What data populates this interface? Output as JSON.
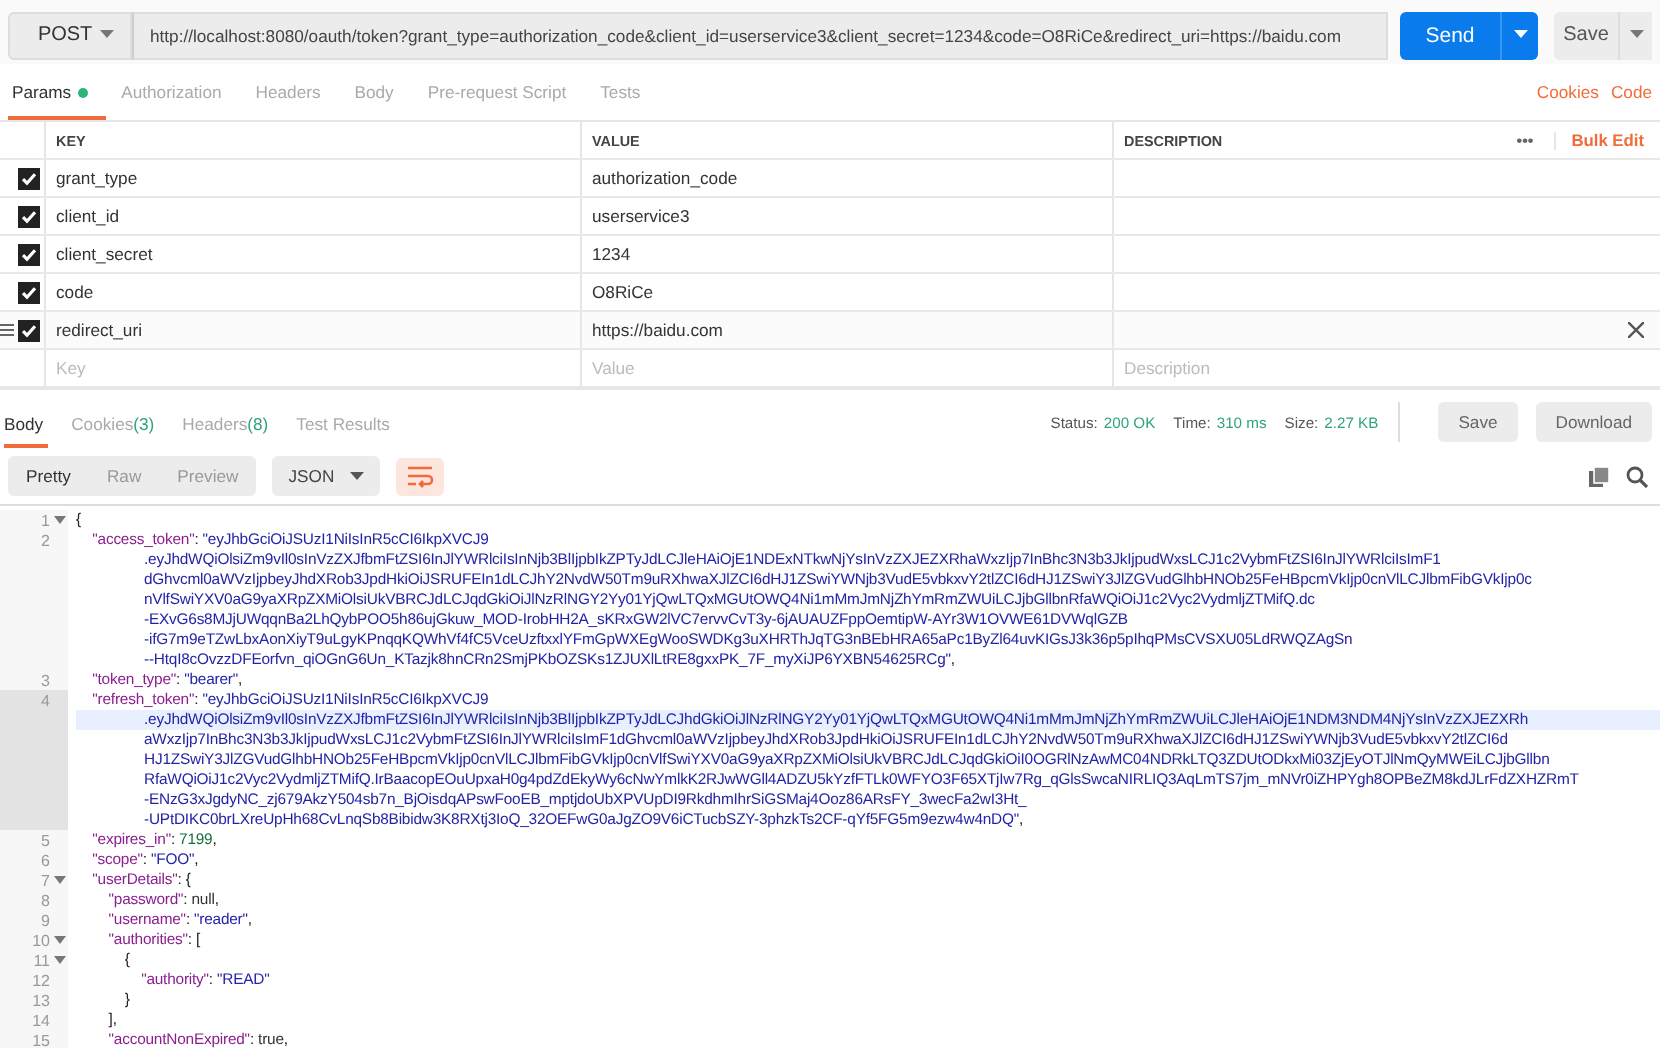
{
  "request": {
    "method": "POST",
    "url": "http://localhost:8080/oauth/token?grant_type=authorization_code&client_id=userservice3&client_secret=1234&code=O8RiCe&redirect_uri=https://baidu.com",
    "send_label": "Send",
    "save_label": "Save"
  },
  "request_tabs": [
    {
      "label": "Params",
      "selected": true,
      "dot": true
    },
    {
      "label": "Authorization",
      "selected": false,
      "dot": false
    },
    {
      "label": "Headers",
      "selected": false,
      "dot": false
    },
    {
      "label": "Body",
      "selected": false,
      "dot": false
    },
    {
      "label": "Pre-request Script",
      "selected": false,
      "dot": false
    },
    {
      "label": "Tests",
      "selected": false,
      "dot": false
    }
  ],
  "request_links": [
    "Cookies",
    "Code"
  ],
  "params": {
    "columns": [
      "KEY",
      "VALUE",
      "DESCRIPTION"
    ],
    "more": "•••",
    "bulk_edit": "Bulk Edit",
    "rows": [
      {
        "key": "grant_type",
        "value": "authorization_code",
        "checked": true,
        "hovered": false
      },
      {
        "key": "client_id",
        "value": "userservice3",
        "checked": true,
        "hovered": false
      },
      {
        "key": "client_secret",
        "value": "1234",
        "checked": true,
        "hovered": false
      },
      {
        "key": "code",
        "value": "O8RiCe",
        "checked": true,
        "hovered": false
      },
      {
        "key": "redirect_uri",
        "value": "https://baidu.com",
        "checked": true,
        "hovered": true
      }
    ],
    "new_row": [
      {
        "placeholder": "Key"
      },
      {
        "placeholder": "Value"
      },
      {
        "placeholder": "Description"
      }
    ]
  },
  "response_tabs": [
    {
      "label": "Body",
      "selected": true
    },
    {
      "label": "Cookies",
      "count": "(3)",
      "selected": false
    },
    {
      "label": "Headers",
      "count": "(8)",
      "selected": false
    },
    {
      "label": "Test Results",
      "selected": false
    }
  ],
  "response_meta": [
    {
      "label": "Status:",
      "value": "200 OK"
    },
    {
      "label": "Time:",
      "value": "310 ms"
    },
    {
      "label": "Size:",
      "value": "2.27 KB"
    }
  ],
  "response_buttons": [
    "Save",
    "Download"
  ],
  "view_modes": [
    {
      "label": "Pretty",
      "selected": true
    },
    {
      "label": "Raw",
      "selected": false
    },
    {
      "label": "Preview",
      "selected": false
    }
  ],
  "format": "JSON",
  "code_lines": [
    {
      "number": "1",
      "fold": true,
      "rows": [
        {
          "cursor": false,
          "tokens": [
            {
              "kind": "punct",
              "text": "{"
            }
          ]
        }
      ]
    },
    {
      "number": "2",
      "fold": false,
      "rows": [
        {
          "cursor": false,
          "tokens": [
            {
              "kind": "key",
              "text": "    \"access_token\""
            },
            {
              "kind": "punct",
              "text": ": "
            },
            {
              "kind": "string",
              "text": "\"eyJhbGciOiJSUzI1NiIsInR5cCI6IkpXVCJ9"
            }
          ]
        },
        {
          "cursor": false,
          "tokens": [
            {
              "kind": "string",
              "text": ".eyJhdWQiOlsiZm9vIl0sInVzZXJfbmFtZSI6InJlYWRlciIsInNjb3BlIjpbIkZPTyJdLCJleHAiOjE1NDExNTkwNjYsInVzZXJEZXRhaWxzIjp7InBhc3N3b3JkIjpudWxsLCJ1c2VybmFtZSI6InJlYWRlciIsImF1"
            }
          ]
        },
        {
          "cursor": false,
          "tokens": [
            {
              "kind": "string",
              "text": "dGhvcml0aWVzIjpbeyJhdXRob3JpdHkiOiJSRUFEIn1dLCJhY2NvdW50Tm9uRXhwaXJlZCI6dHJ1ZSwiYWNjb3VudE5vbkxvY2tlZCI6dHJ1ZSwiY3JlZGVudGlhbHNOb25FeHBpcmVkIjp0cnVlLCJlbmFibGVkIjp0c"
            }
          ]
        },
        {
          "cursor": false,
          "tokens": [
            {
              "kind": "string",
              "text": "nVlfSwiYXV0aG9yaXRpZXMiOlsiUkVBRCJdLCJqdGkiOiJlNzRlNGY2Yy01YjQwLTQxMGUtOWQ4Ni1mMmJmNjZhYmRmZWUiLCJjbGllbnRfaWQiOiJ1c2Vyc2VydmljZTMifQ.dc"
            }
          ]
        },
        {
          "cursor": false,
          "tokens": [
            {
              "kind": "string",
              "text": "-EXvG6s8MJjUWqqnBa2LhQybPOO5h86ujGkuw_MOD-IrobHH2A_sKRxGW2lVC7ervvCvT3y-6jAUAUZFppOemtipW-AYr3W1OVWE61DVWqlGZB"
            }
          ]
        },
        {
          "cursor": false,
          "tokens": [
            {
              "kind": "string",
              "text": "-ifG7m9eTZwLbxAonXiyT9uLgyKPnqqKQWhVf4fC5VceUzftxxlYFmGpWXEgWooSWDKg3uXHRThJqTG3nBEbHRA65aPc1ByZl64uvKIGsJ3k36p5pIhqPMsCVSXU05LdRWQZAgSn"
            }
          ]
        },
        {
          "cursor": false,
          "tokens": [
            {
              "kind": "string",
              "text": "--HtqI8cOvzzDFEorfvn_qiOGnG6Un_KTazjk8hnCRn2SmjPKbOZSKs1ZJUXlLtRE8gxxPK_7F_myXiJP6YXBN54625RCg\""
            },
            {
              "kind": "punct",
              "text": ","
            }
          ]
        }
      ]
    },
    {
      "number": "3",
      "fold": false,
      "rows": [
        {
          "cursor": false,
          "tokens": [
            {
              "kind": "key",
              "text": "    \"token_type\""
            },
            {
              "kind": "punct",
              "text": ": "
            },
            {
              "kind": "string",
              "text": "\"bearer\""
            },
            {
              "kind": "punct",
              "text": ","
            }
          ]
        }
      ]
    },
    {
      "number": "4",
      "fold": false,
      "rows": [
        {
          "cursor": false,
          "tokens": [
            {
              "kind": "key",
              "text": "    \"refresh_token\""
            },
            {
              "kind": "punct",
              "text": ": "
            },
            {
              "kind": "string",
              "text": "\"eyJhbGciOiJSUzI1NiIsInR5cCI6IkpXVCJ9"
            }
          ]
        },
        {
          "cursor": true,
          "tokens": [
            {
              "kind": "string",
              "text": ".eyJhdWQiOlsiZm9vIl0sInVzZXJfbmFtZSI6InJlYWRlciIsInNjb3BlIjpbIkZPTyJdLCJhdGkiOiJlNzRlNGY2Yy01YjQwLTQxMGUtOWQ4Ni1mMmJmNjZhYmRmZWUiLCJleHAiOjE1NDM3NDM4NjYsInVzZXJEZXRh"
            }
          ]
        },
        {
          "cursor": false,
          "tokens": [
            {
              "kind": "string",
              "text": "aWxzIjp7InBhc3N3b3JkIjpudWxsLCJ1c2VybmFtZSI6InJlYWRlciIsImF1dGhvcml0aWVzIjpbeyJhdXRob3JpdHkiOiJSRUFEIn1dLCJhY2NvdW50Tm9uRXhwaXJlZCI6dHJ1ZSwiYWNjb3VudE5vbkxvY2tlZCI6d"
            }
          ]
        },
        {
          "cursor": false,
          "tokens": [
            {
              "kind": "string",
              "text": "HJ1ZSwiY3JlZGVudGlhbHNOb25FeHBpcmVkIjp0cnVlLCJlbmFibGVkIjp0cnVlfSwiYXV0aG9yaXRpZXMiOlsiUkVBRCJdLCJqdGkiOiI0OGRlNzAwMC04NDRkLTQ3ZDUtODkxMi03ZjEyOTJlNmQyMWEiLCJjbGllbn"
            }
          ]
        },
        {
          "cursor": false,
          "tokens": [
            {
              "kind": "string",
              "text": "RfaWQiOiJ1c2Vyc2VydmljZTMifQ.IrBaacopEOuUpxaH0g4pdZdEkyWy6cNwYmlkK2RJwWGll4ADZU5kYzfFTLk0WFYO3F65XTjIw7Rg_qGlsSwcaNIRLIQ3AqLmTS7jm_mNVr0iZHPYgh8OPBeZM8kdJLrFdZXHZRmT"
            }
          ]
        },
        {
          "cursor": false,
          "tokens": [
            {
              "kind": "string",
              "text": "-ENzG3xJgdyNC_zj679AkzY504sb7n_BjOisdqAPswFooEB_mptjdoUbXPVUpDI9RkdhmIhrSiGSMaj4Ooz86ARsFY_3wecFa2wI3Ht_"
            }
          ]
        },
        {
          "cursor": false,
          "tokens": [
            {
              "kind": "string",
              "text": "-UPtDIKC0brLXreUpHh68CvLnqSb8Bibidw3K8RXtj3IoQ_32OEFwG0aJgZO9V6iCTucbSZY-3phzkTs2CF-qYf5FG5m9ezw4w4nDQ\""
            },
            {
              "kind": "punct",
              "text": ","
            }
          ]
        }
      ]
    },
    {
      "number": "5",
      "fold": false,
      "rows": [
        {
          "cursor": false,
          "tokens": [
            {
              "kind": "key",
              "text": "    \"expires_in\""
            },
            {
              "kind": "punct",
              "text": ": "
            },
            {
              "kind": "number",
              "text": "7199"
            },
            {
              "kind": "punct",
              "text": ","
            }
          ]
        }
      ]
    },
    {
      "number": "6",
      "fold": false,
      "rows": [
        {
          "cursor": false,
          "tokens": [
            {
              "kind": "key",
              "text": "    \"scope\""
            },
            {
              "kind": "punct",
              "text": ": "
            },
            {
              "kind": "string",
              "text": "\"FOO\""
            },
            {
              "kind": "punct",
              "text": ","
            }
          ]
        }
      ]
    },
    {
      "number": "7",
      "fold": true,
      "rows": [
        {
          "cursor": false,
          "tokens": [
            {
              "kind": "key",
              "text": "    \"userDetails\""
            },
            {
              "kind": "punct",
              "text": ": {"
            }
          ]
        }
      ]
    },
    {
      "number": "8",
      "fold": false,
      "rows": [
        {
          "cursor": false,
          "tokens": [
            {
              "kind": "key",
              "text": "        \"password\""
            },
            {
              "kind": "punct",
              "text": ": "
            },
            {
              "kind": "atom",
              "text": "null"
            },
            {
              "kind": "punct",
              "text": ","
            }
          ]
        }
      ]
    },
    {
      "number": "9",
      "fold": false,
      "rows": [
        {
          "cursor": false,
          "tokens": [
            {
              "kind": "key",
              "text": "        \"username\""
            },
            {
              "kind": "punct",
              "text": ": "
            },
            {
              "kind": "string",
              "text": "\"reader\""
            },
            {
              "kind": "punct",
              "text": ","
            }
          ]
        }
      ]
    },
    {
      "number": "10",
      "fold": true,
      "rows": [
        {
          "cursor": false,
          "tokens": [
            {
              "kind": "key",
              "text": "        \"authorities\""
            },
            {
              "kind": "punct",
              "text": ": ["
            }
          ]
        }
      ]
    },
    {
      "number": "11",
      "fold": true,
      "rows": [
        {
          "cursor": false,
          "tokens": [
            {
              "kind": "punct",
              "text": "            {"
            }
          ]
        }
      ]
    },
    {
      "number": "12",
      "fold": false,
      "rows": [
        {
          "cursor": false,
          "tokens": [
            {
              "kind": "key",
              "text": "                \"authority\""
            },
            {
              "kind": "punct",
              "text": ": "
            },
            {
              "kind": "string",
              "text": "\"READ\""
            }
          ]
        }
      ]
    },
    {
      "number": "13",
      "fold": false,
      "rows": [
        {
          "cursor": false,
          "tokens": [
            {
              "kind": "punct",
              "text": "            }"
            }
          ]
        }
      ]
    },
    {
      "number": "14",
      "fold": false,
      "rows": [
        {
          "cursor": false,
          "tokens": [
            {
              "kind": "punct",
              "text": "        ],"
            }
          ]
        }
      ]
    },
    {
      "number": "15",
      "fold": false,
      "rows": [
        {
          "cursor": false,
          "tokens": [
            {
              "kind": "key",
              "text": "        \"accountNonExpired\""
            },
            {
              "kind": "punct",
              "text": ": "
            },
            {
              "kind": "atom",
              "text": "true"
            },
            {
              "kind": "punct",
              "text": ","
            }
          ]
        }
      ]
    }
  ]
}
